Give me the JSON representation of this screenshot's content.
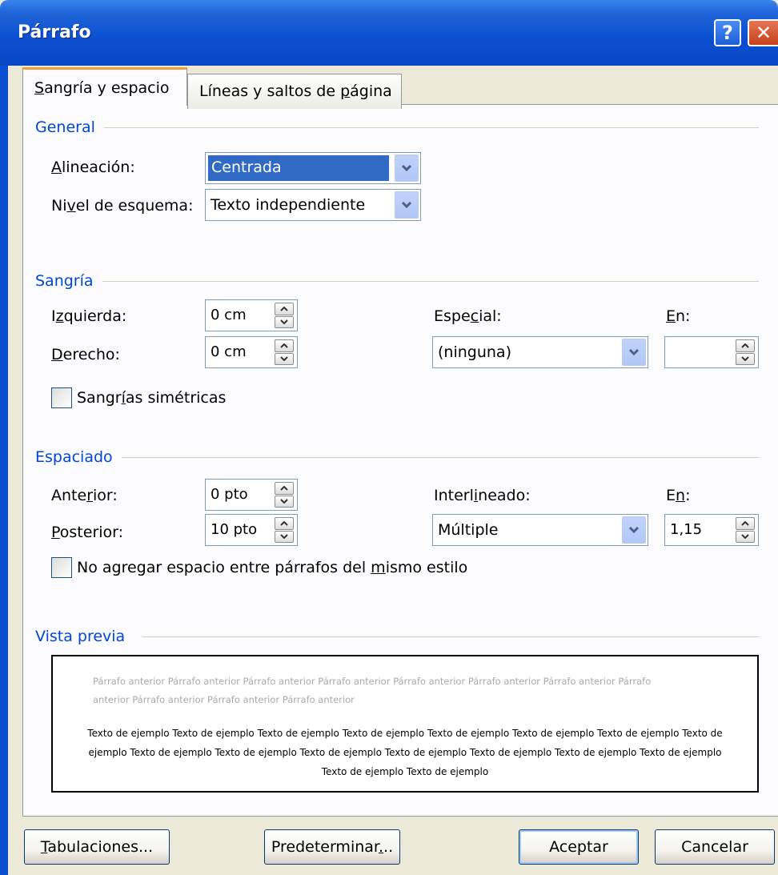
{
  "window": {
    "title": "Párrafo",
    "help_glyph": "?",
    "close_glyph": "✕"
  },
  "tabs": [
    {
      "label_pre": "",
      "mnemonic": "S",
      "label_post": "angría y espacio",
      "active": true
    },
    {
      "label_pre": "Líneas y saltos de ",
      "mnemonic": "p",
      "label_post": "ágina",
      "active": false
    }
  ],
  "general": {
    "title": "General",
    "alignment": {
      "label_pre": "",
      "mnemonic": "A",
      "label_post": "lineación:",
      "value": "Centrada"
    },
    "outline": {
      "label_pre": "Ni",
      "mnemonic": "v",
      "label_post": "el de esquema:",
      "value": "Texto independiente"
    }
  },
  "indent": {
    "title": "Sangría",
    "left": {
      "label_pre": "I",
      "mnemonic": "z",
      "label_post": "quierda:",
      "value": "0 cm"
    },
    "right": {
      "label_pre": "",
      "mnemonic": "D",
      "label_post": "erecho:",
      "value": "0 cm"
    },
    "special": {
      "label_pre": "Espe",
      "mnemonic": "c",
      "label_post": "ial:",
      "value": "(ninguna)"
    },
    "by": {
      "label_pre": "",
      "mnemonic": "E",
      "label_post": "n:",
      "value": ""
    },
    "mirror": {
      "label_pre": "Sangr",
      "mnemonic": "í",
      "label_post": "as simétricas",
      "checked": false
    }
  },
  "spacing": {
    "title": "Espaciado",
    "before": {
      "label_pre": "Ante",
      "mnemonic": "r",
      "label_post": "ior:",
      "value": "0 pto"
    },
    "after": {
      "label_pre": "",
      "mnemonic": "P",
      "label_post": "osterior:",
      "value": "10 pto"
    },
    "line": {
      "label_pre": "Interl",
      "mnemonic": "i",
      "label_post": "neado:",
      "value": "Múltiple"
    },
    "at": {
      "label_pre": "E",
      "mnemonic": "n",
      "label_post": ":",
      "value": "1,15"
    },
    "no_space": {
      "label_pre": "No agregar espacio entre párrafos del ",
      "mnemonic": "m",
      "label_post": "ismo estilo",
      "checked": false
    }
  },
  "preview": {
    "title": "Vista previa",
    "previous_text": "Párrafo anterior Párrafo anterior Párrafo anterior Párrafo anterior Párrafo anterior Párrafo anterior Párrafo anterior Párrafo anterior Párrafo anterior Párrafo anterior Párrafo anterior",
    "sample_text": "Texto de ejemplo Texto de ejemplo Texto de ejemplo Texto de ejemplo Texto de ejemplo Texto de ejemplo Texto de ejemplo Texto de ejemplo Texto de ejemplo Texto de ejemplo Texto de ejemplo Texto de ejemplo Texto de ejemplo Texto de ejemplo Texto de ejemplo Texto de ejemplo Texto de ejemplo"
  },
  "buttons": {
    "tabs": {
      "label_pre": "",
      "mnemonic": "T",
      "label_post": "abulaciones..."
    },
    "default": {
      "label_pre": "Predeterminar",
      "mnemonic": ".",
      "label_post": ".."
    },
    "ok": {
      "label": "Aceptar"
    },
    "cancel": {
      "label": "Cancelar"
    }
  },
  "icons": {
    "dropdown": "chevron-down-icon",
    "spin_up": "spin-up-icon",
    "spin_down": "spin-down-icon"
  },
  "colors": {
    "title_bar": "#0a4fd0",
    "group_title": "#0046d5",
    "selection": "#316ac5",
    "tab_highlight": "#f3a13a"
  }
}
